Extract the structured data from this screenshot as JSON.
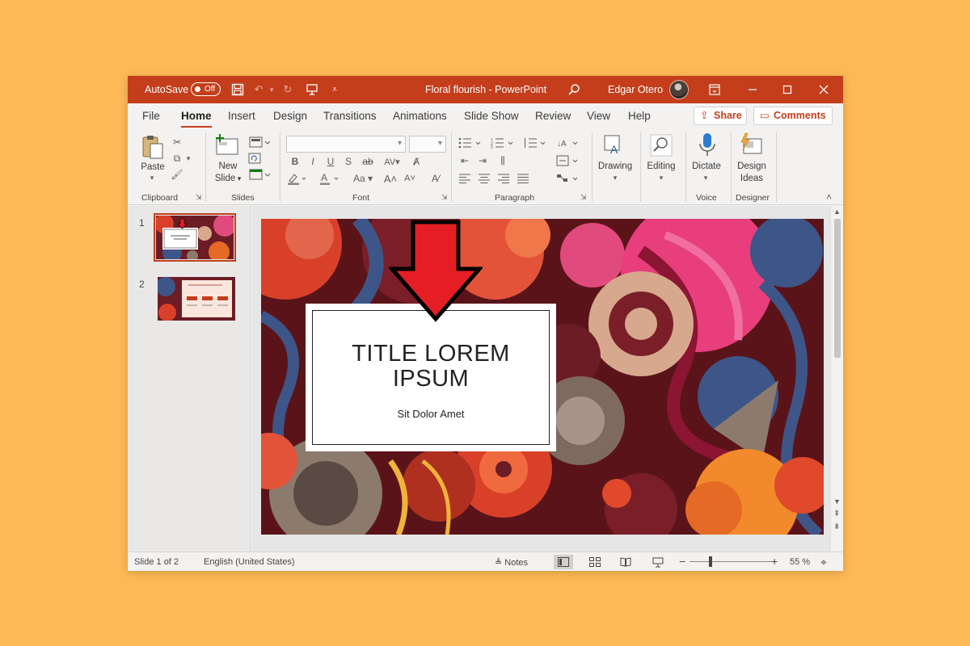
{
  "titlebar": {
    "autosave_label": "AutoSave",
    "autosave_state": "Off",
    "doc_title": "Floral flourish",
    "separator": "-",
    "app_name": "PowerPoint",
    "user_name": "Edgar Otero"
  },
  "tabs": [
    "File",
    "Home",
    "Insert",
    "Design",
    "Transitions",
    "Animations",
    "Slide Show",
    "Review",
    "View",
    "Help"
  ],
  "active_tab": "Home",
  "share_label": "Share",
  "comments_label": "Comments",
  "ribbon": {
    "paste_label": "Paste",
    "new_slide_label_1": "New",
    "new_slide_label_2": "Slide",
    "drawing_label": "Drawing",
    "editing_label": "Editing",
    "dictate_label": "Dictate",
    "design_ideas_label_1": "Design",
    "design_ideas_label_2": "Ideas",
    "groups": {
      "clipboard": "Clipboard",
      "slides": "Slides",
      "font": "Font",
      "paragraph": "Paragraph",
      "voice": "Voice",
      "designer": "Designer"
    }
  },
  "thumbnails": [
    {
      "number": "1",
      "selected": true
    },
    {
      "number": "2",
      "selected": false
    }
  ],
  "slide": {
    "title_line1": "TITLE LOREM",
    "title_line2": "IPSUM",
    "subtitle": "Sit Dolor Amet"
  },
  "statusbar": {
    "slide_count": "Slide 1 of 2",
    "language": "English (United States)",
    "notes_label": "Notes",
    "zoom_minus": "−",
    "zoom_plus": "+",
    "zoom_level": "55 %"
  },
  "colors": {
    "accent": "#C43E1C",
    "background": "#FDB956",
    "arrow": "#E41E24"
  }
}
